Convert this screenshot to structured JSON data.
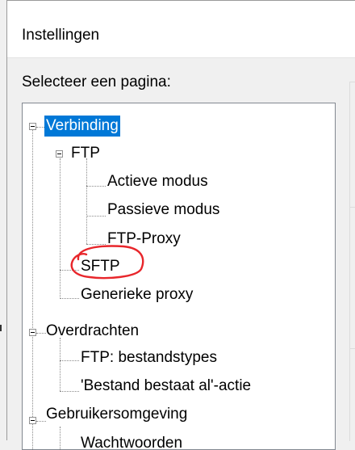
{
  "dialog": {
    "title": "Instellingen",
    "select_label": "Selecteer een pagina:"
  },
  "tree": {
    "items": [
      {
        "label": "Verbinding",
        "selected": true
      },
      {
        "label": "FTP"
      },
      {
        "label": "Actieve modus"
      },
      {
        "label": "Passieve modus"
      },
      {
        "label": "FTP-Proxy"
      },
      {
        "label": "SFTP",
        "annotated": true
      },
      {
        "label": "Generieke proxy"
      },
      {
        "label": "Overdrachten"
      },
      {
        "label": "FTP: bestandstypes"
      },
      {
        "label": "'Bestand bestaat al'-actie"
      },
      {
        "label": "Gebruikersomgeving"
      },
      {
        "label": "Wachtwoorden"
      }
    ]
  },
  "colors": {
    "selection": "#0078d7",
    "annotation": "#e8262b"
  }
}
